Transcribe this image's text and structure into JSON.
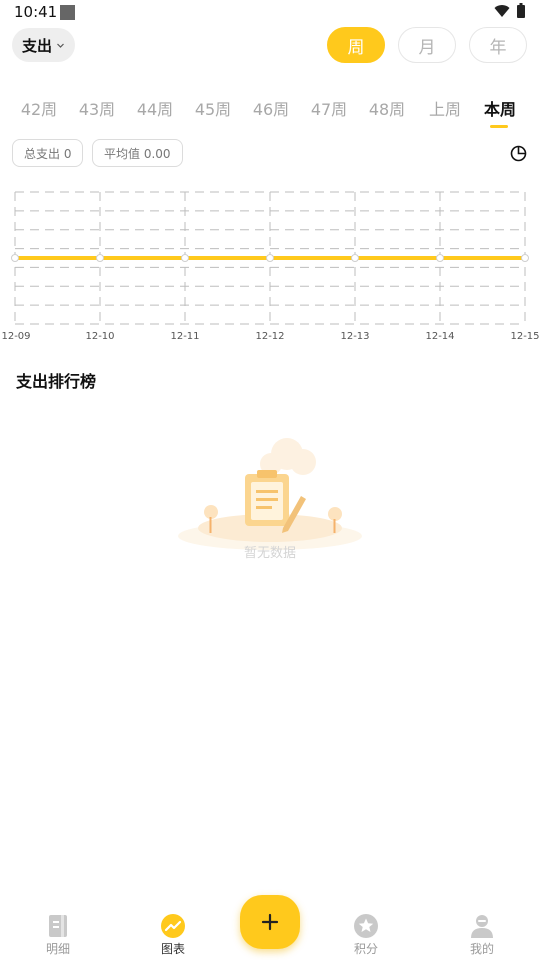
{
  "status_bar": {
    "time": "10:41"
  },
  "header": {
    "type_dropdown_label": "支出",
    "periods": [
      "周",
      "月",
      "年"
    ],
    "active_period": "周"
  },
  "weeks": {
    "tabs": [
      "42周",
      "43周",
      "44周",
      "45周",
      "46周",
      "47周",
      "48周",
      "上周",
      "本周"
    ],
    "active": "本周"
  },
  "summary": {
    "total": "总支出 0",
    "average": "平均值 0.00"
  },
  "chart_data": {
    "type": "line",
    "x": [
      "12-09",
      "12-10",
      "12-11",
      "12-12",
      "12-13",
      "12-14",
      "12-15"
    ],
    "series": [
      {
        "values": [
          0,
          0,
          0,
          0,
          0,
          0,
          0
        ]
      }
    ],
    "grid": true,
    "line_color": "#ffc91c"
  },
  "ranking": {
    "title": "支出排行榜",
    "empty_text": "暂无数据"
  },
  "bottom_nav": {
    "items": [
      {
        "label": "明细",
        "icon": "notebook-icon"
      },
      {
        "label": "图表",
        "icon": "chart-icon"
      },
      {
        "label": "积分",
        "icon": "star-badge-icon"
      },
      {
        "label": "我的",
        "icon": "user-icon"
      }
    ],
    "active": "图表",
    "add_icon": "plus-icon"
  },
  "colors": {
    "accent": "#ffc91c",
    "inactive": "#a8a8a8"
  }
}
